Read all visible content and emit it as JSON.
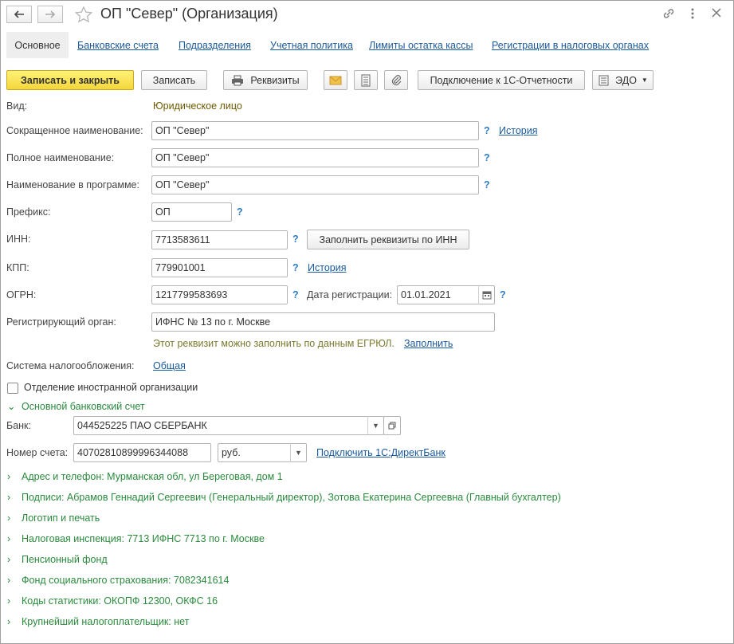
{
  "window": {
    "title": "ОП \"Север\" (Организация)"
  },
  "icons": {
    "back": "arrow-left-icon",
    "forward": "arrow-right-icon",
    "favorite": "star-icon",
    "link": "link-icon",
    "more": "more-vertical-icon",
    "close": "close-icon"
  },
  "tabs": [
    {
      "label": "Основное",
      "active": true
    },
    {
      "label": "Банковские счета"
    },
    {
      "label": "Подразделения"
    },
    {
      "label": "Учетная политика"
    },
    {
      "label": "Лимиты остатка кассы"
    },
    {
      "label": "Регистрации в налоговых органах"
    }
  ],
  "toolbar": {
    "save_close": "Записать и закрыть",
    "save": "Записать",
    "requisites": "Реквизиты",
    "connect_reporting": "Подключение к 1С-Отчетности",
    "edo": "ЭДО"
  },
  "form": {
    "kind_label": "Вид:",
    "kind_value": "Юридическое лицо",
    "short_name_label": "Сокращенное наименование:",
    "short_name_value": "ОП \"Север\"",
    "history_link": "История",
    "full_name_label": "Полное наименование:",
    "full_name_value": "ОП \"Север\"",
    "program_name_label": "Наименование в программе:",
    "program_name_value": "ОП \"Север\"",
    "prefix_label": "Префикс:",
    "prefix_value": "ОП",
    "inn_label": "ИНН:",
    "inn_value": "7713583611",
    "fill_by_inn": "Заполнить реквизиты по ИНН",
    "kpp_label": "КПП:",
    "kpp_value": "779901001",
    "kpp_history": "История",
    "ogrn_label": "ОГРН:",
    "ogrn_value": "1217799583693",
    "reg_date_label": "Дата регистрации:",
    "reg_date_value": "01.01.2021",
    "reg_authority_label": "Регистрирующий орган:",
    "reg_authority_value": "ИФНС № 13 по г. Москве",
    "egrul_hint": "Этот реквизит можно заполнить по данным ЕГРЮЛ.",
    "egrul_fill": "Заполнить",
    "tax_system_label": "Система налогообложения:",
    "tax_system_value": "Общая",
    "foreign_branch": "Отделение иностранной организации",
    "foreign_branch_checked": false,
    "q": "?"
  },
  "bank": {
    "section_title": "Основной банковский счет",
    "bank_label": "Банк:",
    "bank_value": "044525225 ПАО СБЕРБАНК",
    "account_label": "Номер счета:",
    "account_value": "40702810899996344088",
    "currency_value": "руб.",
    "directbank_link": "Подключить 1С:ДиректБанк"
  },
  "sections": [
    "Адрес и телефон: Мурманская обл, ул Береговая, дом 1",
    "Подписи: Абрамов Геннадий Сергеевич (Генеральный директор), Зотова Екатерина Сергеевна (Главный бухгалтер)",
    "Логотип и печать",
    "Налоговая инспекция: 7713 ИФНС 7713 по г. Москве",
    "Пенсионный фонд",
    "Фонд социального страхования: 7082341614",
    "Коды статистики: ОКОПФ 12300, ОКФС 16",
    "Крупнейший налогоплательщик: нет"
  ],
  "colors": {
    "link": "#1a5a9c",
    "green": "#2a8a3c",
    "question": "#2f7ec4",
    "primary_button": "#f3d63a"
  }
}
